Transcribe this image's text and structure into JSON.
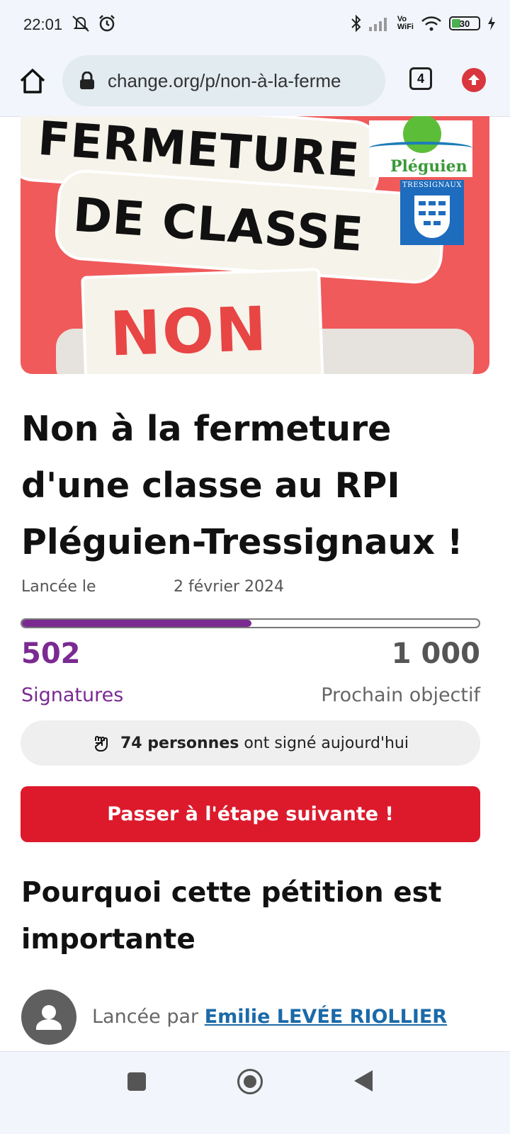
{
  "status_bar": {
    "time": "22:01",
    "battery_level": "30",
    "icons": [
      "mute-icon",
      "alarm-icon",
      "bluetooth-icon",
      "signal-icon",
      "vowifi-icon",
      "wifi-icon",
      "battery-icon",
      "charging-icon"
    ],
    "vowifi_label_top": "Vo",
    "vowifi_label_bottom": "WiFi"
  },
  "browser": {
    "url": "change.org/p/non-à-la-ferme",
    "tab_count": "4"
  },
  "banner": {
    "line1": "FERMETURE",
    "line2": "DE CLASSE",
    "line3": "NON !",
    "logo1_text": "Pléguien",
    "logo2_text": "TRESSIGNAUX"
  },
  "petition": {
    "title": "Non à la fermeture d'une classe au RPI Pléguien-Tressignaux !",
    "launched_label": "Lancée le",
    "launched_date": "2 février 2024",
    "signatures_count": "502",
    "signatures_label": "Signatures",
    "goal": "1 000",
    "goal_label": "Prochain objectif",
    "progress_fraction": 0.502,
    "today_count": "74 personnes",
    "today_text": "ont signé aujourd'hui",
    "cta_label": "Passer à l'étape suivante !",
    "why_heading": "Pourquoi cette pétition est importante",
    "author_prefix": "Lancée par",
    "author_name": "Emilie LEVÉE RIOLLIER"
  },
  "colors": {
    "accent_purple": "#7a2a91",
    "cta_red": "#dc1a2c",
    "banner_red": "#f05a5a",
    "link_blue": "#1b6aa8"
  }
}
